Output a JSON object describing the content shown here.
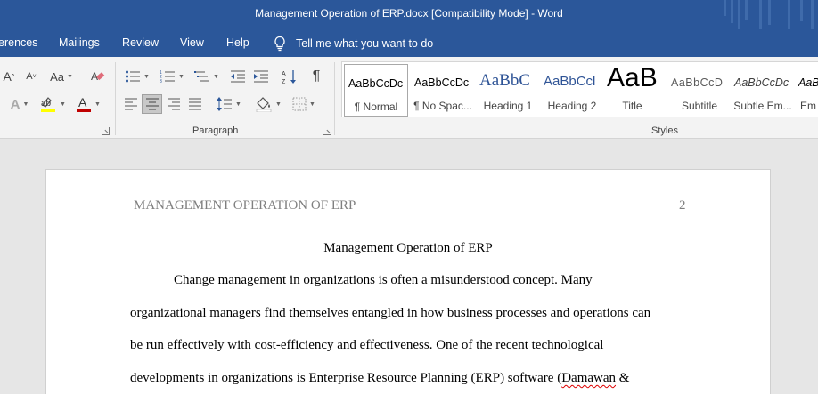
{
  "window": {
    "title": "Management Operation of ERP.docx [Compatibility Mode]  -  Word"
  },
  "tabs": [
    {
      "label": "erences"
    },
    {
      "label": "Mailings"
    },
    {
      "label": "Review"
    },
    {
      "label": "View"
    },
    {
      "label": "Help"
    }
  ],
  "tell_me": {
    "label": "Tell me what you want to do"
  },
  "ribbon": {
    "font_group": {
      "grow_label": "A",
      "shrink_label": "A",
      "case_label": "Aa",
      "text_effects_label": "A",
      "font_color_label": "A",
      "highlight_color": "#ffff00",
      "font_color": "#c00000"
    },
    "paragraph_group": {
      "label": "Paragraph"
    },
    "styles_group": {
      "label": "Styles"
    },
    "styles": [
      {
        "sample": "AaBbCcDc",
        "name": "¶ Normal"
      },
      {
        "sample": "AaBbCcDc",
        "name": "¶ No Spac..."
      },
      {
        "sample": "AaBbC",
        "name": "Heading 1"
      },
      {
        "sample": "AaBbCcl",
        "name": "Heading 2"
      },
      {
        "sample": "AaB",
        "name": "Title"
      },
      {
        "sample": "AaBbCcD",
        "name": "Subtitle"
      },
      {
        "sample": "AaBbCcDc",
        "name": "Subtle Em..."
      },
      {
        "sample": "AaBl",
        "name": "Em"
      }
    ]
  },
  "document": {
    "header_left": "MANAGEMENT OPERATION OF ERP",
    "page_number": "2",
    "title": "Management Operation of ERP",
    "lines": [
      "Change management in organizations is often a misunderstood concept. Many",
      "organizational managers find themselves entangled in how business processes and operations can",
      "be run effectively with cost-efficiency and effectiveness. One of the recent technological",
      "developments in organizations is Enterprise Resource Planning (ERP) software ("
    ],
    "last_line_squiggle": "Damawan",
    "last_line_tail": " &"
  },
  "colors": {
    "ribbon_blue": "#2b579a",
    "heading_blue": "#2f5496"
  }
}
